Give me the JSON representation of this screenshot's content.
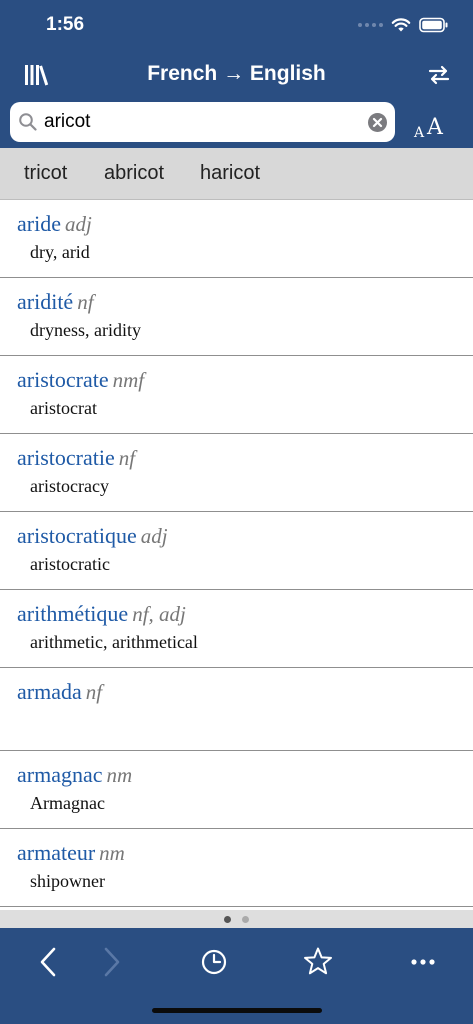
{
  "status": {
    "time": "1:56"
  },
  "header": {
    "title": "French → English"
  },
  "search": {
    "value": "aricot"
  },
  "font_size": {
    "small": "A",
    "large": "A"
  },
  "suggestions": [
    "tricot",
    "abricot",
    "haricot"
  ],
  "entries": [
    {
      "headword": "aride",
      "pos": "adj",
      "translation": "dry, arid"
    },
    {
      "headword": "aridité",
      "pos": "nf",
      "translation": "dryness, aridity"
    },
    {
      "headword": "aristocrate",
      "pos": "nmf",
      "translation": "aristocrat"
    },
    {
      "headword": "aristocratie",
      "pos": "nf",
      "translation": "aristocracy"
    },
    {
      "headword": "aristocratique",
      "pos": "adj",
      "translation": "aristocratic"
    },
    {
      "headword": "arithmétique",
      "pos": "nf, adj",
      "translation": "arithmetic, arithmetical"
    },
    {
      "headword": "armada",
      "pos": "nf",
      "translation": ""
    },
    {
      "headword": "armagnac",
      "pos": "nm",
      "translation": "Armagnac"
    },
    {
      "headword": "armateur",
      "pos": "nm",
      "translation": "shipowner"
    }
  ],
  "pager": {
    "pages": 2,
    "current": 1
  },
  "toolbar": {
    "back_icon": "chevron-left",
    "forward_icon": "chevron-right",
    "history_icon": "clock",
    "favorites_icon": "star",
    "more_icon": "ellipsis"
  },
  "colors": {
    "bar": "#2a4e82",
    "headword": "#1f5aa6",
    "pos": "#777777",
    "suggest_bar": "#d8d8d8"
  }
}
